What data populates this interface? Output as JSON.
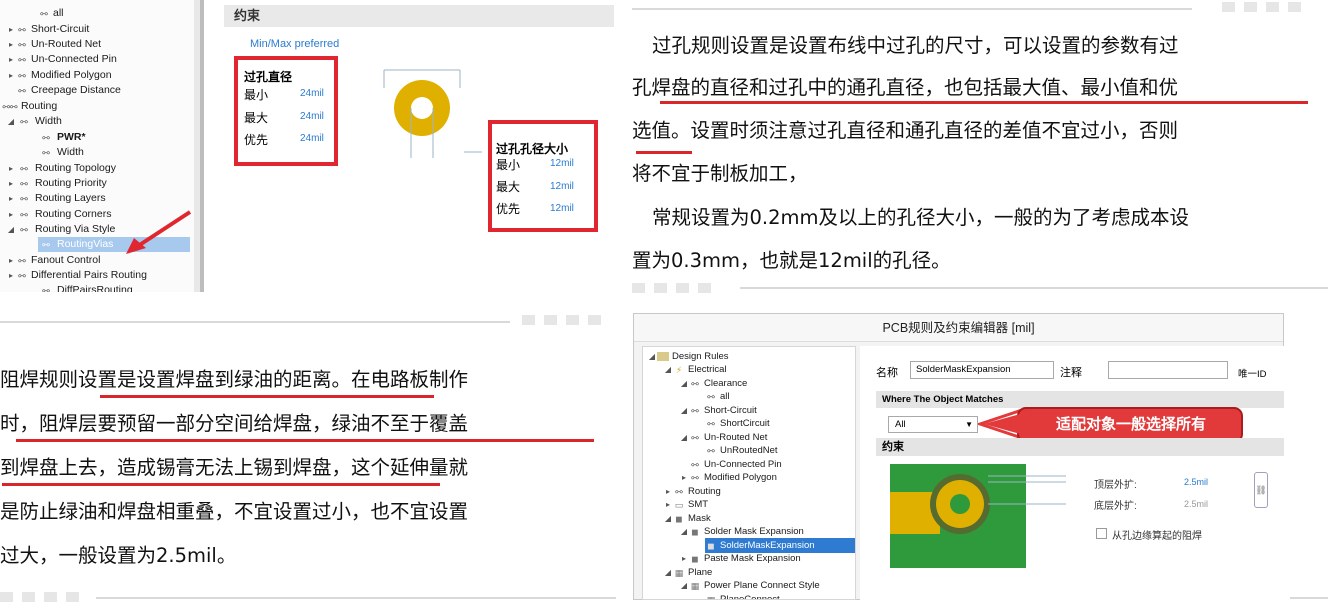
{
  "top_left_tree": {
    "items": [
      {
        "label": "all",
        "arrow": ""
      },
      {
        "label": "Short-Circuit",
        "arrow": "▸"
      },
      {
        "label": "Un-Routed Net",
        "arrow": "▸"
      },
      {
        "label": "Un-Connected Pin",
        "arrow": "▸"
      },
      {
        "label": "Modified Polygon",
        "arrow": "▸"
      },
      {
        "label": "Creepage Distance",
        "arrow": ""
      },
      {
        "label": "Routing",
        "arrow": ""
      },
      {
        "label": "Width",
        "arrow": "◢"
      },
      {
        "label": "PWR*",
        "arrow": ""
      },
      {
        "label": "Width",
        "arrow": ""
      },
      {
        "label": "Routing Topology",
        "arrow": "▸"
      },
      {
        "label": "Routing Priority",
        "arrow": "▸"
      },
      {
        "label": "Routing Layers",
        "arrow": "▸"
      },
      {
        "label": "Routing Corners",
        "arrow": "▸"
      },
      {
        "label": "Routing Via Style",
        "arrow": "◢"
      },
      {
        "label": "RoutingVias",
        "arrow": ""
      },
      {
        "label": "Fanout Control",
        "arrow": "▸"
      },
      {
        "label": "Differential Pairs Routing",
        "arrow": "▸"
      },
      {
        "label": "DiffPairsRouting",
        "arrow": ""
      }
    ]
  },
  "via_panel": {
    "header": "约束",
    "mode": "Min/Max preferred",
    "via_diameter": {
      "title": "过孔直径",
      "rows": [
        {
          "k": "最小",
          "v": "24mil"
        },
        {
          "k": "最大",
          "v": "24mil"
        },
        {
          "k": "优先",
          "v": "24mil"
        }
      ]
    },
    "hole_size": {
      "title": "过孔孔径大小",
      "rows": [
        {
          "k": "最小",
          "v": "12mil"
        },
        {
          "k": "最大",
          "v": "12mil"
        },
        {
          "k": "优先",
          "v": "12mil"
        }
      ]
    },
    "colors": {
      "pad": "#e0b000",
      "accent_red": "#e0262f",
      "blue": "#2a7bd1"
    }
  },
  "via_text": {
    "para1_line1": "过孔规则设置是设置布线中过孔的尺寸，可以设置的参数有过",
    "para1_line2": "孔焊盘的直径和过孔中的通孔直径，也包括最大值、最小值和优",
    "para1_line3": "选值。设置时须注意过孔直径和通孔直径的差值不宜过小，否则",
    "para1_line4": "将不宜于制板加工，",
    "para2_line1": "常规设置为0.2mm及以上的孔径大小，一般的为了考虑成本设",
    "para2_line2": "置为0.3mm，也就是12mil的孔径。"
  },
  "mask_text": {
    "line1": "阻焊规则设置是设置焊盘到绿油的距离。在电路板制作",
    "line2": "时，阻焊层要预留一部分空间给焊盘，绿油不至于覆盖",
    "line3": "到焊盘上去，造成锡膏无法上锡到焊盘，这个延伸量就",
    "line4": "是防止绿油和焊盘相重叠，不宜设置过小，也不宜设置",
    "line5": "过大，一般设置为2.5mil。"
  },
  "editor": {
    "title": "PCB规则及约束编辑器 [mil]",
    "tree": [
      {
        "label": "Design Rules",
        "level": 0,
        "arrow": "◢"
      },
      {
        "label": "Electrical",
        "level": 1,
        "arrow": "◢"
      },
      {
        "label": "Clearance",
        "level": 2,
        "arrow": "◢"
      },
      {
        "label": "all",
        "level": 3,
        "arrow": ""
      },
      {
        "label": "Short-Circuit",
        "level": 2,
        "arrow": "◢"
      },
      {
        "label": "ShortCircuit",
        "level": 3,
        "arrow": ""
      },
      {
        "label": "Un-Routed Net",
        "level": 2,
        "arrow": "◢"
      },
      {
        "label": "UnRoutedNet",
        "level": 3,
        "arrow": ""
      },
      {
        "label": "Un-Connected Pin",
        "level": 2,
        "arrow": ""
      },
      {
        "label": "Modified Polygon",
        "level": 2,
        "arrow": "▸"
      },
      {
        "label": "Routing",
        "level": 1,
        "arrow": "▸"
      },
      {
        "label": "SMT",
        "level": 1,
        "arrow": "▸"
      },
      {
        "label": "Mask",
        "level": 1,
        "arrow": "◢"
      },
      {
        "label": "Solder Mask Expansion",
        "level": 2,
        "arrow": "◢"
      },
      {
        "label": "SolderMaskExpansion",
        "level": 3,
        "arrow": ""
      },
      {
        "label": "Paste Mask Expansion",
        "level": 2,
        "arrow": "▸"
      },
      {
        "label": "Plane",
        "level": 1,
        "arrow": "◢"
      },
      {
        "label": "Power Plane Connect Style",
        "level": 2,
        "arrow": "◢"
      },
      {
        "label": "PlaneConnect",
        "level": 3,
        "arrow": ""
      }
    ],
    "name_label": "名称",
    "name_value": "SolderMaskExpansion",
    "comment_label": "注释",
    "id_label": "唯一ID",
    "where_header": "Where The Object Matches",
    "select_value": "All",
    "callout": "适配对象一般选择所有",
    "constraints_header": "约束",
    "top_label": "顶层外扩:",
    "top_value": "2.5mil",
    "bottom_label": "底层外扩:",
    "bottom_value": "2.5mil",
    "checkbox_label": "从孔边缘算起的阻焊",
    "colors": {
      "green": "#2f9a3c",
      "pad": "#e0b000",
      "callout_red": "#e23a3a"
    }
  }
}
